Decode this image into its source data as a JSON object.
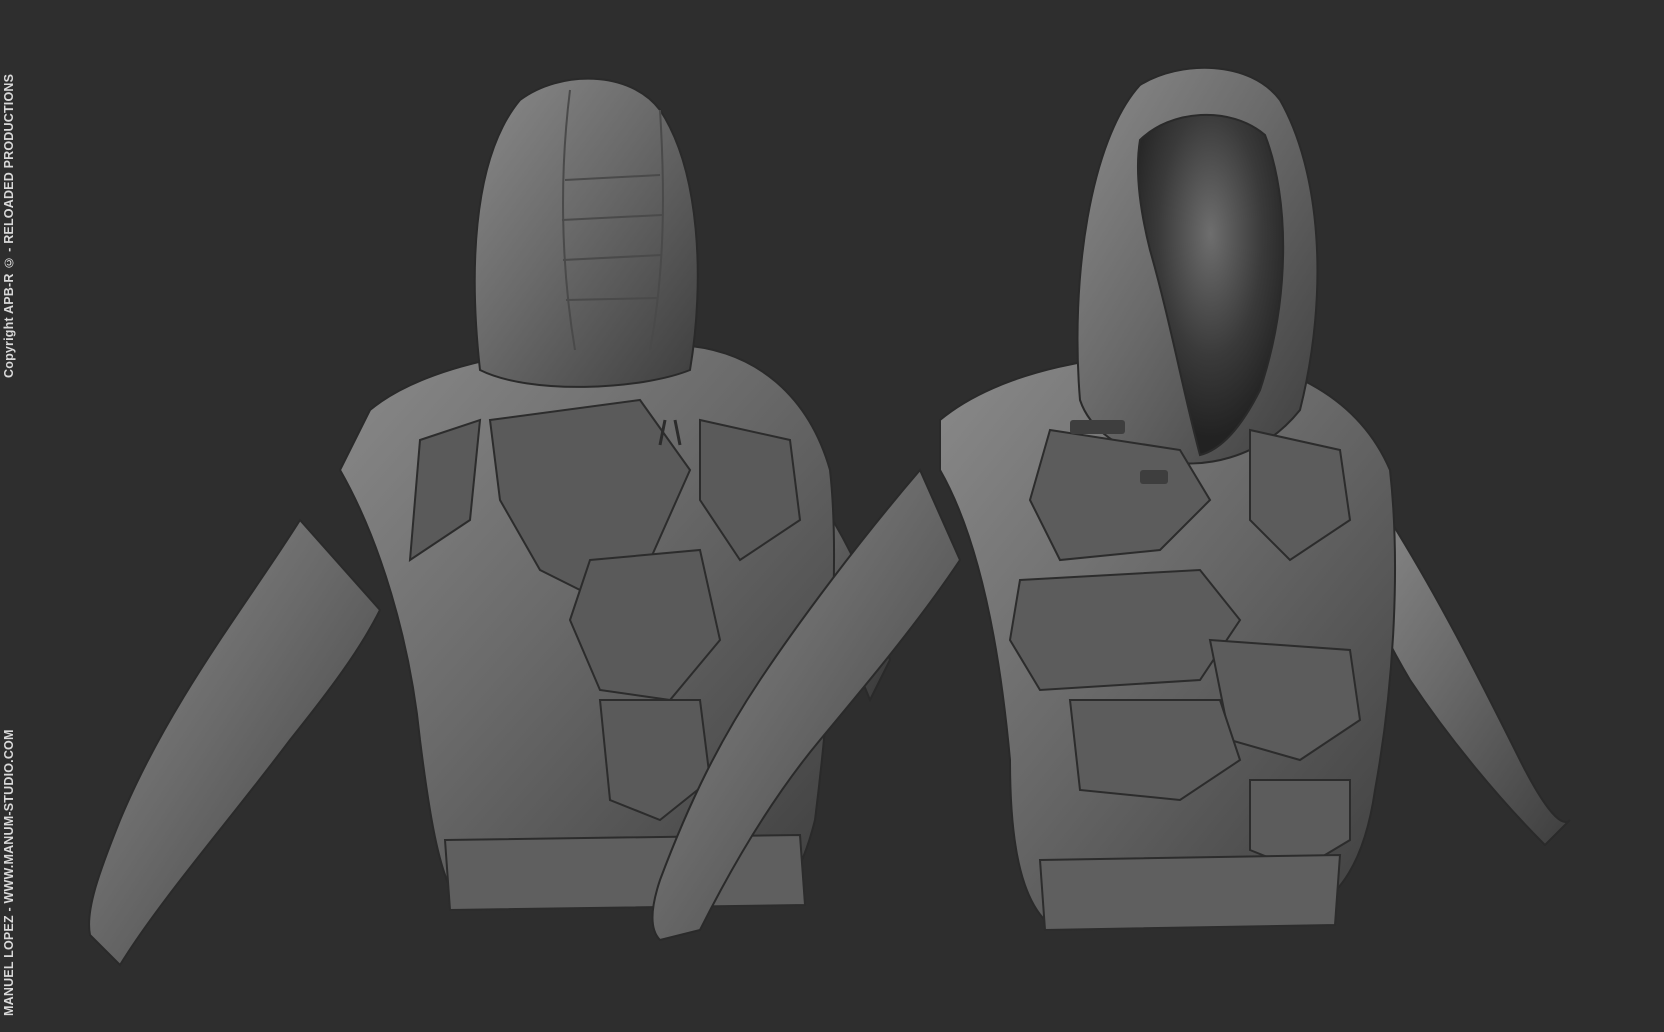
{
  "background_color": "#2e2e2e",
  "model_color": "#6a6a6a",
  "subject": "sculpted hooded armored jacket, back and front views",
  "watermarks": {
    "top": "Copyright APB-R © - RELOADED PRODUCTIONS",
    "bottom": "MANUEL LOPEZ - WWW.MANUM-STUDIO.COM"
  }
}
